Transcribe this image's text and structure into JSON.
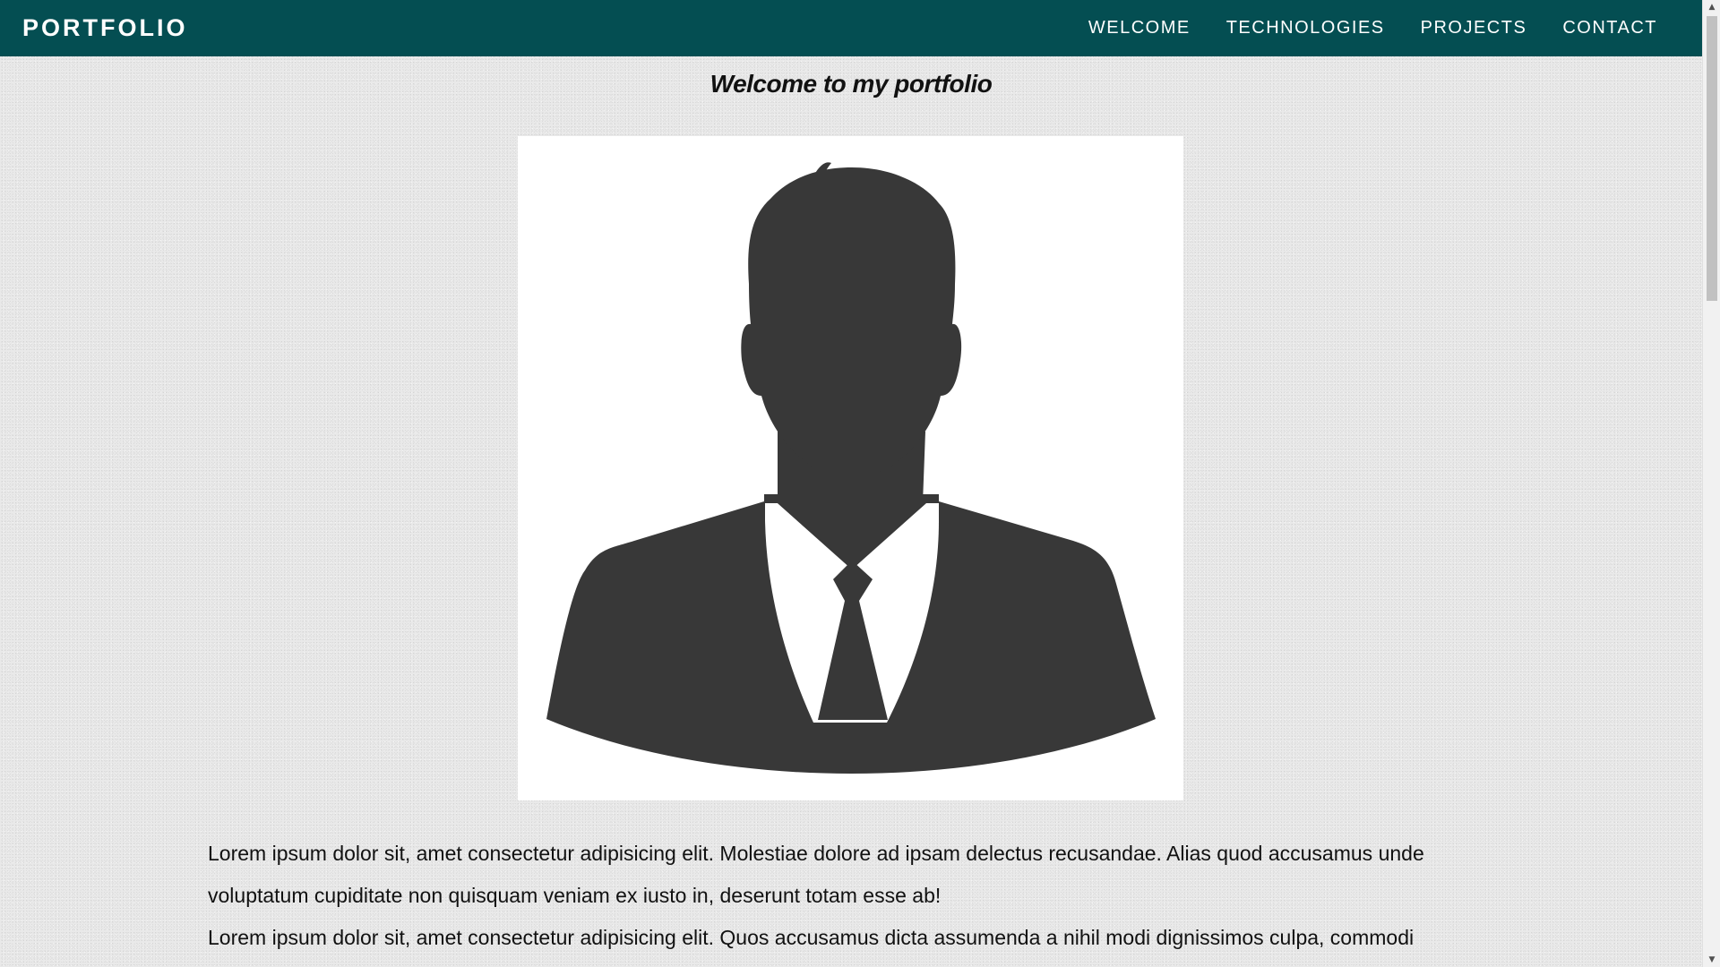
{
  "navbar": {
    "brand": "PORTFOLIO",
    "background_color": "#044e52",
    "links": [
      {
        "label": "WELCOME"
      },
      {
        "label": "TECHNOLOGIES"
      },
      {
        "label": "PROJECTS"
      },
      {
        "label": "CONTACT"
      }
    ]
  },
  "main": {
    "title": "Welcome to my portfolio",
    "profile_image": {
      "icon": "person-silhouette-icon"
    },
    "paragraphs": [
      "Lorem ipsum dolor sit, amet consectetur adipisicing elit. Molestiae dolore ad ipsam delectus recusandae. Alias quod accusamus unde voluptatum cupiditate non quisquam veniam ex iusto in, deserunt totam esse ab!",
      "Lorem ipsum dolor sit, amet consectetur adipisicing elit. Quos accusamus dicta assumenda a nihil modi dignissimos culpa, commodi"
    ]
  },
  "colors": {
    "page_background": "#e9e9e9",
    "silhouette": "#383838"
  }
}
